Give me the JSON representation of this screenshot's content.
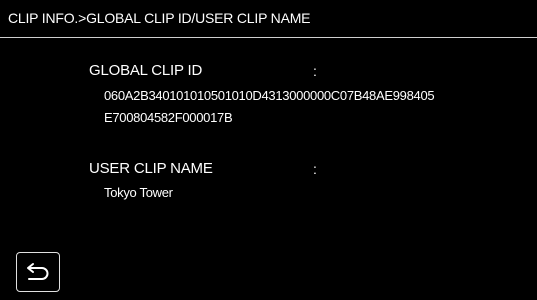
{
  "header": {
    "title": "CLIP INFO.>GLOBAL CLIP ID/USER CLIP NAME"
  },
  "global_clip_id": {
    "label": "GLOBAL CLIP ID",
    "colon": ":",
    "value_line1": "060A2B340101010501010D4313000000C07B48AE998405",
    "value_line2": "E700804582F000017B"
  },
  "user_clip_name": {
    "label": "USER CLIP NAME",
    "colon": ":",
    "value": "Tokyo Tower"
  },
  "footer": {
    "back_icon": "return-arrow-icon"
  }
}
